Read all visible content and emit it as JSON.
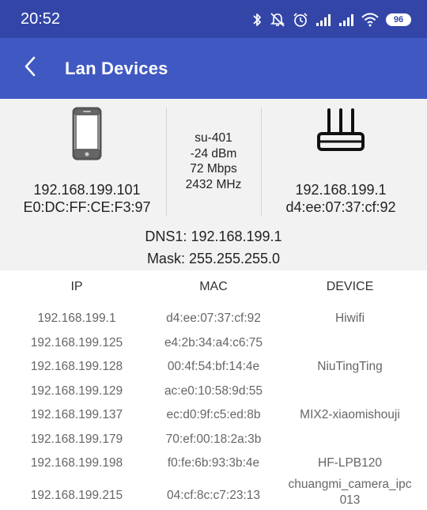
{
  "status_bar": {
    "time": "20:52",
    "battery": "96",
    "icons": [
      "bluetooth-icon",
      "alarm-off-icon",
      "alarm-icon",
      "signal-icon",
      "signal-icon",
      "wifi-icon",
      "battery-icon"
    ]
  },
  "app_bar": {
    "title": "Lan Devices",
    "background": "#3f58c2",
    "status_background": "#3346a8"
  },
  "local_device": {
    "ip": "192.168.199.101",
    "mac": "E0:DC:FF:CE:F3:97",
    "icon": "smartphone-icon"
  },
  "connection": {
    "ssid": "su-401",
    "signal": "-24 dBm",
    "speed": "72 Mbps",
    "frequency": "2432 MHz"
  },
  "router": {
    "ip": "192.168.199.1",
    "mac": "d4:ee:07:37:cf:92",
    "icon": "router-icon"
  },
  "network": {
    "dns": "DNS1: 192.168.199.1",
    "mask": "Mask: 255.255.255.0"
  },
  "table": {
    "headers": [
      "IP",
      "MAC",
      "DEVICE"
    ],
    "rows": [
      {
        "ip": "192.168.199.1",
        "mac": "d4:ee:07:37:cf:92",
        "device": "Hiwifi"
      },
      {
        "ip": "192.168.199.125",
        "mac": "e4:2b:34:a4:c6:75",
        "device": ""
      },
      {
        "ip": "192.168.199.128",
        "mac": "00:4f:54:bf:14:4e",
        "device": "NiuTingTing"
      },
      {
        "ip": "192.168.199.129",
        "mac": "ac:e0:10:58:9d:55",
        "device": ""
      },
      {
        "ip": "192.168.199.137",
        "mac": "ec:d0:9f:c5:ed:8b",
        "device": "MIX2-xiaomishouji"
      },
      {
        "ip": "192.168.199.179",
        "mac": "70:ef:00:18:2a:3b",
        "device": ""
      },
      {
        "ip": "192.168.199.198",
        "mac": "f0:fe:6b:93:3b:4e",
        "device": "HF-LPB120"
      },
      {
        "ip": "192.168.199.215",
        "mac": "04:cf:8c:c7:23:13",
        "device_line1": "chuangmi_camera_ipc",
        "device_line2": "013"
      }
    ]
  }
}
